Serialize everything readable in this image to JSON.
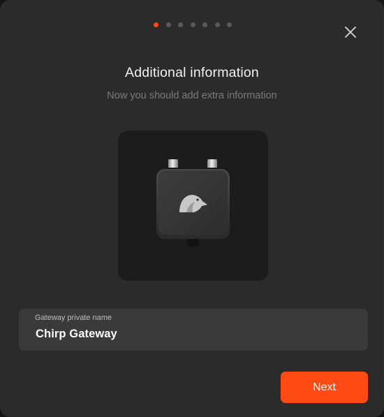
{
  "stepper": {
    "total_steps": 7,
    "current_step": 1
  },
  "dialog": {
    "title": "Additional information",
    "subtitle": "Now you should add extra information"
  },
  "illustration": {
    "icon": "gateway-device-icon"
  },
  "form": {
    "gateway_name_label": "Gateway private name",
    "gateway_name_value": "Chirp Gateway"
  },
  "actions": {
    "next_label": "Next",
    "close_icon": "close-icon"
  },
  "colors": {
    "accent": "#ff4a14",
    "background": "#2b2b2b",
    "card": "#1c1c1c",
    "field": "#3a3a3a",
    "inactive_dot": "#5a5a5a"
  }
}
